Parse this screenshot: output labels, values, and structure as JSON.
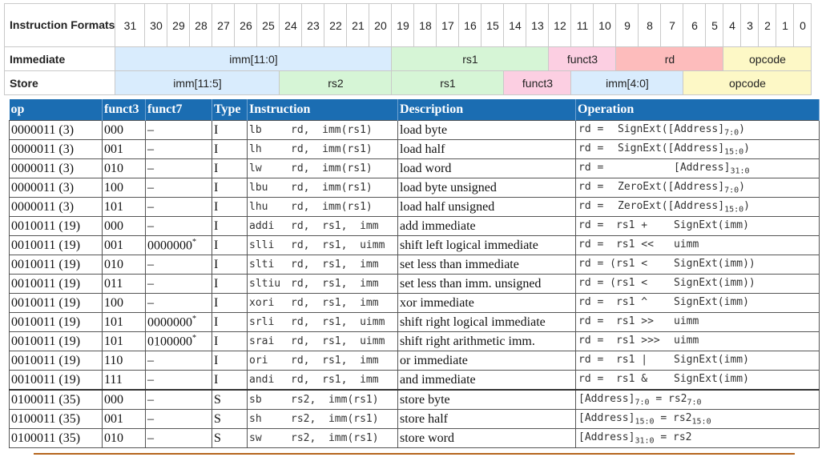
{
  "formats": {
    "header_label": "Instruction Formats",
    "bits": [
      "31",
      "30",
      "29",
      "28",
      "27",
      "26",
      "25",
      "24",
      "23",
      "22",
      "21",
      "20",
      "19",
      "18",
      "17",
      "16",
      "15",
      "14",
      "13",
      "12",
      "11",
      "10",
      "9",
      "8",
      "7",
      "6",
      "5",
      "4",
      "3",
      "2",
      "1",
      "0"
    ],
    "rows": [
      {
        "label": "Immediate",
        "fields": [
          {
            "text": "imm[11:0]",
            "color": "#d9ecfd"
          },
          {
            "text": "rs1",
            "color": "#d6f5d6"
          },
          {
            "text": "funct3",
            "color": "#fccfe2"
          },
          {
            "text": "rd",
            "color": "#fdbcbc"
          },
          {
            "text": "opcode",
            "color": "#fdf8c6"
          }
        ]
      },
      {
        "label": "Store",
        "fields": [
          {
            "text": "imm[11:5]",
            "color": "#d9ecfd"
          },
          {
            "text": "rs2",
            "color": "#d6f5d6"
          },
          {
            "text": "rs1",
            "color": "#d6f5d6"
          },
          {
            "text": "funct3",
            "color": "#fccfe2"
          },
          {
            "text": "imm[4:0]",
            "color": "#d9ecfd"
          },
          {
            "text": "opcode",
            "color": "#fdf8c6"
          }
        ]
      }
    ]
  },
  "table": {
    "headers": [
      "op",
      "funct3",
      "funct7",
      "Type",
      "Instruction",
      "Description",
      "Operation"
    ],
    "header_color": "#1b6db2",
    "rows": [
      {
        "op": "0000011 (3)",
        "f3": "000",
        "f7": "–",
        "type": "I",
        "mn": "lb",
        "args": "rd,  imm(rs1)",
        "desc": "load byte",
        "lhs": "rd =",
        "rhs": "SignExt([Address]",
        "sub": "7:0",
        "tail": ")"
      },
      {
        "op": "0000011 (3)",
        "f3": "001",
        "f7": "–",
        "type": "I",
        "mn": "lh",
        "args": "rd,  imm(rs1)",
        "desc": "load half",
        "lhs": "rd =",
        "rhs": "SignExt([Address]",
        "sub": "15:0",
        "tail": ")"
      },
      {
        "op": "0000011 (3)",
        "f3": "010",
        "f7": "–",
        "type": "I",
        "mn": "lw",
        "args": "rd,  imm(rs1)",
        "desc": "load word",
        "lhs": "rd =",
        "rhs": "[Address]",
        "sub": "31:0",
        "tail": ""
      },
      {
        "op": "0000011 (3)",
        "f3": "100",
        "f7": "–",
        "type": "I",
        "mn": "lbu",
        "args": "rd,  imm(rs1)",
        "desc": "load byte unsigned",
        "lhs": "rd =",
        "rhs": "ZeroExt([Address]",
        "sub": "7:0",
        "tail": ")"
      },
      {
        "op": "0000011 (3)",
        "f3": "101",
        "f7": "–",
        "type": "I",
        "mn": "lhu",
        "args": "rd,  imm(rs1)",
        "desc": "load half unsigned",
        "lhs": "rd =",
        "rhs": "ZeroExt([Address]",
        "sub": "15:0",
        "tail": ")"
      },
      {
        "op": "0010011 (19)",
        "f3": "000",
        "f7": "–",
        "type": "I",
        "mn": "addi",
        "args": "rd,  rs1,  imm",
        "desc": "add immediate",
        "lhs": "rd =  rs1 +",
        "rhs": "SignExt(imm)",
        "sub": "",
        "tail": ""
      },
      {
        "op": "0010011 (19)",
        "f3": "001",
        "f7": "0000000",
        "f7sup": "*",
        "type": "I",
        "mn": "slli",
        "args": "rd,  rs1,  uimm",
        "desc": "shift left logical immediate",
        "lhs": "rd =  rs1 <<",
        "rhs": "uimm",
        "sub": "",
        "tail": ""
      },
      {
        "op": "0010011 (19)",
        "f3": "010",
        "f7": "–",
        "type": "I",
        "mn": "slti",
        "args": "rd,  rs1,  imm",
        "desc": "set less than immediate",
        "lhs": "rd = (rs1 <",
        "rhs": "SignExt(imm))",
        "sub": "",
        "tail": ""
      },
      {
        "op": "0010011 (19)",
        "f3": "011",
        "f7": "–",
        "type": "I",
        "mn": "sltiu",
        "args": "rd,  rs1,  imm",
        "desc": "set less than imm. unsigned",
        "lhs": "rd = (rs1 <",
        "rhs": "SignExt(imm))",
        "sub": "",
        "tail": ""
      },
      {
        "op": "0010011 (19)",
        "f3": "100",
        "f7": "–",
        "type": "I",
        "mn": "xori",
        "args": "rd,  rs1,  imm",
        "desc": "xor immediate",
        "lhs": "rd =  rs1 ^",
        "rhs": "SignExt(imm)",
        "sub": "",
        "tail": ""
      },
      {
        "op": "0010011 (19)",
        "f3": "101",
        "f7": "0000000",
        "f7sup": "*",
        "type": "I",
        "mn": "srli",
        "args": "rd,  rs1,  uimm",
        "desc": "shift right logical immediate",
        "lhs": "rd =  rs1 >>",
        "rhs": "uimm",
        "sub": "",
        "tail": ""
      },
      {
        "op": "0010011 (19)",
        "f3": "101",
        "f7": "0100000",
        "f7sup": "*",
        "type": "I",
        "mn": "srai",
        "args": "rd,  rs1,  uimm",
        "desc": "shift right arithmetic imm.",
        "lhs": "rd =  rs1 >>>",
        "rhs": "uimm",
        "sub": "",
        "tail": ""
      },
      {
        "op": "0010011 (19)",
        "f3": "110",
        "f7": "–",
        "type": "I",
        "mn": "ori",
        "args": "rd,  rs1,  imm",
        "desc": "or immediate",
        "lhs": "rd =  rs1 |",
        "rhs": "SignExt(imm)",
        "sub": "",
        "tail": ""
      },
      {
        "op": "0010011 (19)",
        "f3": "111",
        "f7": "–",
        "type": "I",
        "mn": "andi",
        "args": "rd,  rs1,  imm",
        "desc": "and immediate",
        "lhs": "rd =  rs1 &",
        "rhs": "SignExt(imm)",
        "sub": "",
        "tail": ""
      },
      {
        "op": "0100011 (35)",
        "f3": "000",
        "f7": "–",
        "type": "S",
        "mn": "sb",
        "args": "rs2,  imm(rs1)",
        "desc": "store byte",
        "store": true,
        "pre": "[Address]",
        "psub": "7:0",
        "mid": " = rs2",
        "msub": "7:0"
      },
      {
        "op": "0100011 (35)",
        "f3": "001",
        "f7": "–",
        "type": "S",
        "mn": "sh",
        "args": "rs2,  imm(rs1)",
        "desc": "store half",
        "store": true,
        "pre": "[Address]",
        "psub": "15:0",
        "mid": " = rs2",
        "msub": "15:0"
      },
      {
        "op": "0100011 (35)",
        "f3": "010",
        "f7": "–",
        "type": "S",
        "mn": "sw",
        "args": "rs2,  imm(rs1)",
        "desc": "store word",
        "store": true,
        "pre": "[Address]",
        "psub": "31:0",
        "mid": " = rs2",
        "msub": ""
      }
    ]
  }
}
